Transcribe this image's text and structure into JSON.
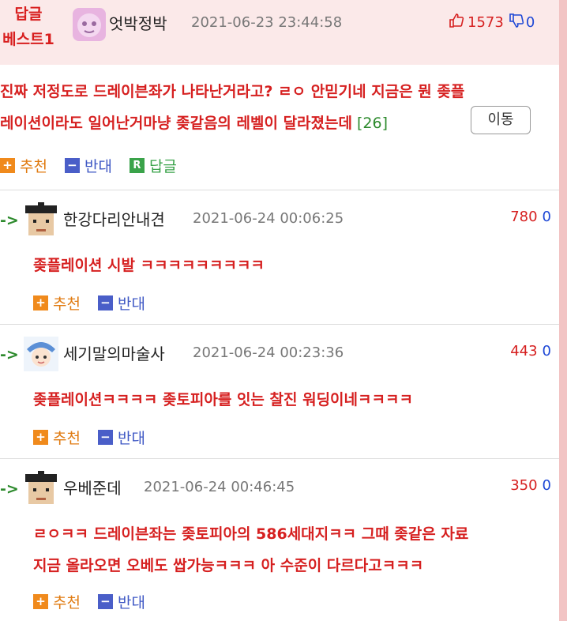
{
  "best": {
    "badge_line1": "답글",
    "badge_line2": "베스트1",
    "nickname": "엇박정박",
    "date": "2021-06-23 23:44:58",
    "up": "1573",
    "down": "0",
    "body_line1": "진짜 저정도로 드레이븐좌가 나타난거라고? ㄹㅇ 안믿기네 지금은 뭔 좆플",
    "body_line2": "레이션이라도 일어난거마냥 좆같음의 레벨이 달라졌는데",
    "reply_count": "[26]",
    "move_label": "이동",
    "recommend_label": "추천",
    "oppose_label": "반대",
    "reply_label": "답글"
  },
  "comments": [
    {
      "nickname": "한강다리안내견",
      "date": "2021-06-24 00:06:25",
      "up": "780",
      "down": "0",
      "lines": [
        "좆플레이션 시발 ㅋㅋㅋㅋㅋㅋㅋㅋㅋ"
      ],
      "recommend_label": "추천",
      "oppose_label": "반대"
    },
    {
      "nickname": "세기말의마술사",
      "date": "2021-06-24 00:23:36",
      "up": "443",
      "down": "0",
      "lines": [
        "좆플레이션ㅋㅋㅋㅋ 좆토피아를 잇는 찰진 워딩이네ㅋㅋㅋㅋ"
      ],
      "recommend_label": "추천",
      "oppose_label": "반대"
    },
    {
      "nickname": "우베준데",
      "date": "2021-06-24 00:46:45",
      "up": "350",
      "down": "0",
      "lines": [
        "ㄹㅇㅋㅋ 드레이븐좌는 좆토피아의 586세대지ㅋㅋ 그때 좆같은 자료",
        "지금 올라오면 오베도 쌉가능ㅋㅋㅋ 아 수준이 다르다고ㅋㅋㅋ"
      ],
      "recommend_label": "추천",
      "oppose_label": "반대"
    }
  ],
  "icons": {
    "plus_box": "+",
    "minus_box": "−",
    "reply_box": "R",
    "reply_arrow": "->"
  },
  "colors": {
    "accent_red": "#d62020",
    "accent_blue": "#1e48d6",
    "best_bg": "#fbe9e9"
  }
}
